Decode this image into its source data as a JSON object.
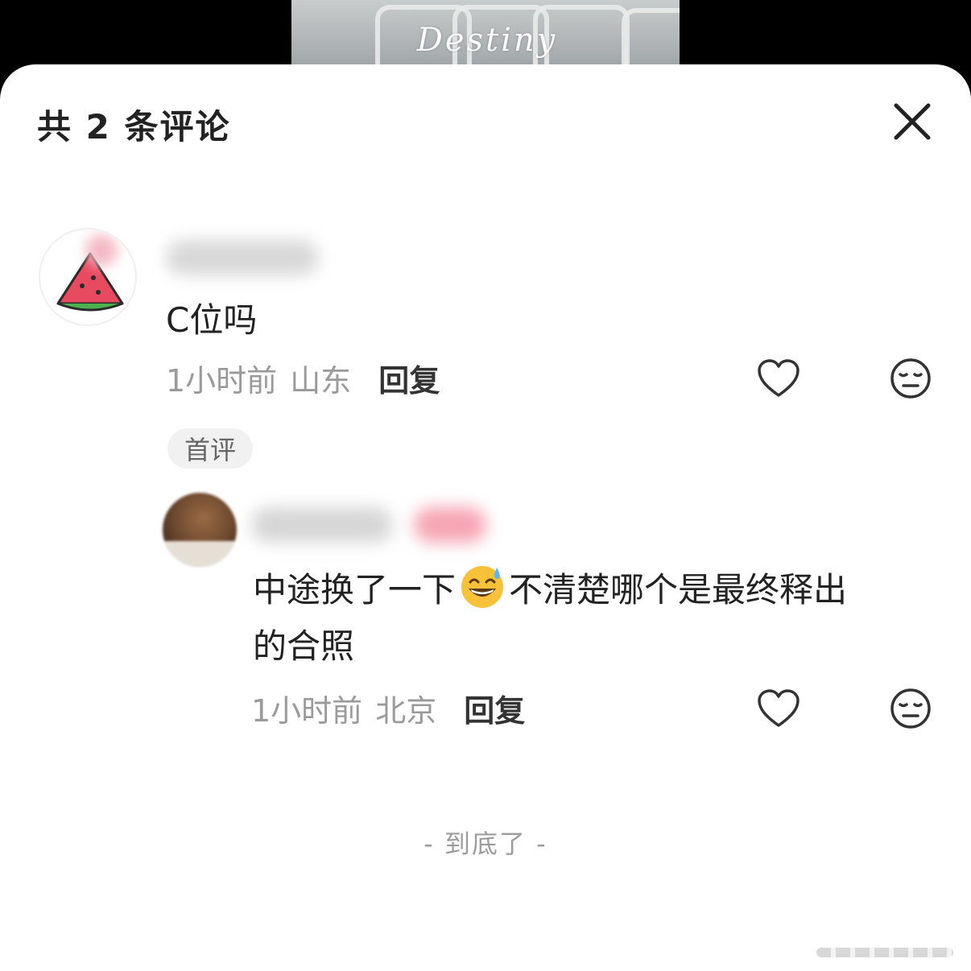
{
  "header": {
    "title": "共 2 条评论"
  },
  "background": {
    "watermark": "Destiny"
  },
  "comments": [
    {
      "username_blurred": true,
      "text": "C位吗",
      "time": "1小时前",
      "location": "山东",
      "reply_label": "回复",
      "badge": "首评"
    },
    {
      "username_blurred": true,
      "text_before_emoji": "中途换了一下",
      "emoji": "grinning-face-with-sweat",
      "text_after_emoji": "不清楚哪个是最终释出",
      "text_line2": "的合照",
      "time": "1小时前",
      "location": "北京",
      "reply_label": "回复"
    }
  ],
  "footer": {
    "end_text": "- 到底了 -"
  },
  "colors": {
    "sheet_bg": "#ffffff",
    "backdrop": "#000000",
    "text_primary": "#222222",
    "text_secondary": "#9a9a9a"
  }
}
